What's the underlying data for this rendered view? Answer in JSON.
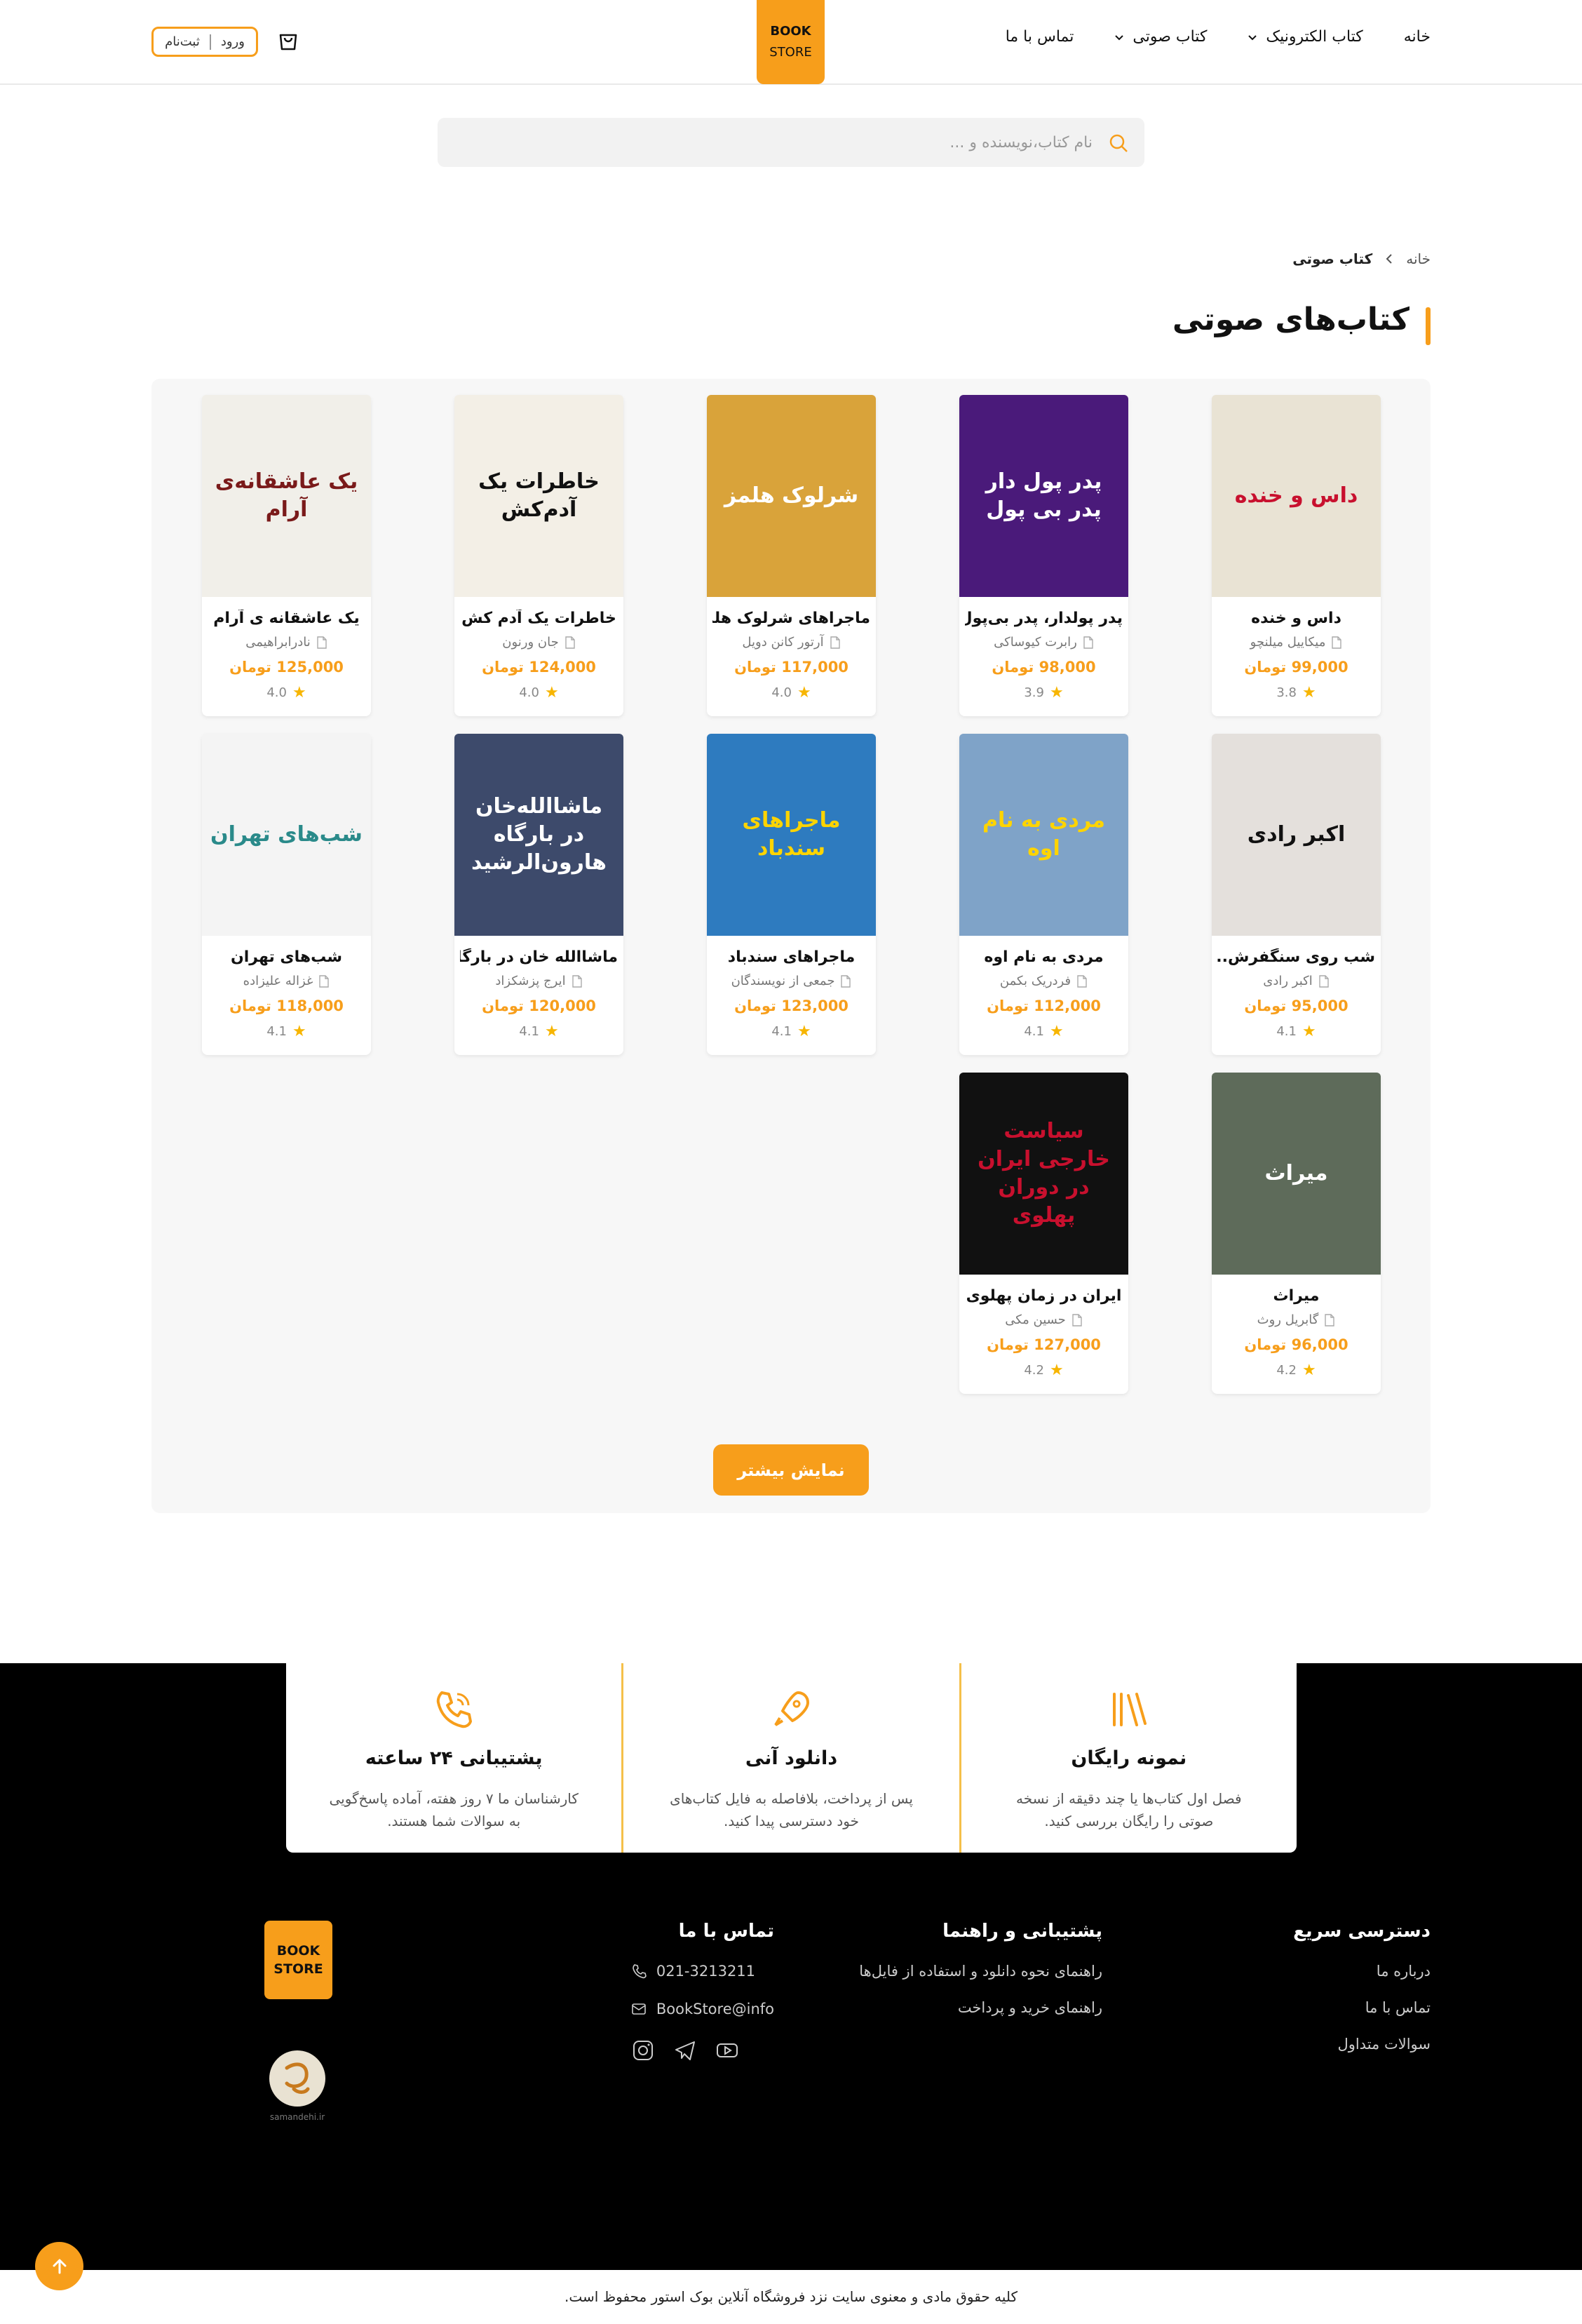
{
  "header": {
    "nav": [
      "خانه",
      "کتاب الکترونیک",
      "کتاب صوتی",
      "تماس با ما"
    ],
    "logo_line1": "BOOK",
    "logo_line2": "STORE",
    "login_label": "ورود",
    "register_label": "ثبت‌نام"
  },
  "search": {
    "placeholder": "نام کتاب،نویسنده و ..."
  },
  "breadcrumb": {
    "home": "خانه",
    "current": "کتاب صوتی"
  },
  "page_title": "کتاب‌های صوتی",
  "books": [
    {
      "title": "داس و خنده",
      "author": "میکاییل میلنچو",
      "price": "99,000 تومان",
      "rating": "3.8",
      "cover_text": "داس و خنده",
      "cover_bg": "#e9e3d4",
      "cover_fg": "#c8102e"
    },
    {
      "title": "پدر پولدار، پدر بی‌پول...",
      "author": "رابرت کیوساکی",
      "price": "98,000 تومان",
      "rating": "3.9",
      "cover_text": "پدر پول دار پدر بی پول",
      "cover_bg": "#4a1a7a",
      "cover_fg": "#ffffff"
    },
    {
      "title": "ماجراهای شرلوک هلم...",
      "author": "آرتور کانن دویل",
      "price": "117,000 تومان",
      "rating": "4.0",
      "cover_text": "شرلوک هلمز",
      "cover_bg": "#d9a33a",
      "cover_fg": "#ffffff"
    },
    {
      "title": "خاطرات یک آدم کش",
      "author": "جان ورنون",
      "price": "124,000 تومان",
      "rating": "4.0",
      "cover_text": "خاطرات یک آدم‌کش",
      "cover_bg": "#f3efe6",
      "cover_fg": "#111111"
    },
    {
      "title": "یک عاشقانه ی آرام",
      "author": "نادرابراهیمی",
      "price": "125,000 تومان",
      "rating": "4.0",
      "cover_text": "یک عاشقانه‌ی آرام",
      "cover_bg": "#f1efe9",
      "cover_fg": "#7a1a1a"
    },
    {
      "title": "شب روی سنگفرش...",
      "author": "اکبر رادی",
      "price": "95,000 تومان",
      "rating": "4.1",
      "cover_text": "اکبر رادی",
      "cover_bg": "#e4e0dc",
      "cover_fg": "#111111"
    },
    {
      "title": "مردی به نام اوه",
      "author": "فردریک بکمن",
      "price": "112,000 تومان",
      "rating": "4.1",
      "cover_text": "مردی به نام اوه",
      "cover_bg": "#7fa3c8",
      "cover_fg": "#ffd400"
    },
    {
      "title": "ماجراهای سندباد",
      "author": "جمعی از نویسندگان",
      "price": "123,000 تومان",
      "rating": "4.1",
      "cover_text": "ماجراهای سندباد",
      "cover_bg": "#2e7bbf",
      "cover_fg": "#ffd400"
    },
    {
      "title": "ماشاالله خان در بارگاه...",
      "author": "ایرج پزشکزاد",
      "price": "120,000 تومان",
      "rating": "4.1",
      "cover_text": "ماشاالله‌خان در بارگاه هارون‌الرشید",
      "cover_bg": "#3d4a6b",
      "cover_fg": "#ffffff"
    },
    {
      "title": "شب‌های تهران",
      "author": "غزاله علیزاده",
      "price": "118,000 تومان",
      "rating": "4.1",
      "cover_text": "شب‌های تهران",
      "cover_bg": "#f4f4f4",
      "cover_fg": "#2a8a8a"
    },
    {
      "title": "میراث",
      "author": "گابریل روث",
      "price": "96,000 تومان",
      "rating": "4.2",
      "cover_text": "میراث",
      "cover_bg": "#5e6b5a",
      "cover_fg": "#ffffff"
    },
    {
      "title": "ایران در زمان پهلوی",
      "author": "حسین مکی",
      "price": "127,000 تومان",
      "rating": "4.2",
      "cover_text": "سیاست خارجی ایران در دوران پهلوی",
      "cover_bg": "#111111",
      "cover_fg": "#c8102e"
    }
  ],
  "more_button": "نمایش بیشتر",
  "features": [
    {
      "title": "نمونه رایگان",
      "text": "فصل اول کتاب‌ها یا چند دقیقه از نسخه صوتی را رایگان بررسی کنید.",
      "icon": "books-icon"
    },
    {
      "title": "دانلود آنی",
      "text": "پس از پرداخت، بلافاصله به فایل کتاب‌های خود دسترسی پیدا کنید.",
      "icon": "rocket-icon"
    },
    {
      "title": "پشتیبانی ۲۴ ساعته",
      "text": "کارشناسان ما ۷ روز هفته، آماده پاسخ‌گویی به سوالات شما هستند.",
      "icon": "phone-icon"
    }
  ],
  "footer": {
    "quick_title": "دسترسی سریع",
    "quick_links": [
      "درباره ما",
      "تماس با ما",
      "سوالات متداول"
    ],
    "support_title": "پشتیبانی و راهنما",
    "support_links": [
      "راهنمای نحوه دانلود و استفاده از فایل‌ها",
      "راهنمای خرید و پرداخت"
    ],
    "contact_title": "تماس با ما",
    "phone": "021-3213211",
    "email": "BookStore@info",
    "samandehi": "samandehi.ir",
    "copyright": "کلیه حقوق مادی و معنوی سایت نزد فروشگاه آنلاین بوک استور محفوظ است."
  },
  "colors": {
    "accent": "#f79e1b",
    "footer_bg": "#000000"
  }
}
